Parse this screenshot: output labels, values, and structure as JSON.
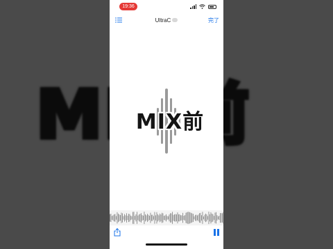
{
  "status_bar": {
    "time": "19:36"
  },
  "nav": {
    "title": "UltraC",
    "done_label": "完了"
  },
  "caption": {
    "text": "MIX前"
  },
  "background": {
    "text": "MIX前"
  },
  "colors": {
    "accent": "#1a73e8",
    "time_pill": "#e53935"
  },
  "icons": {
    "list": "list-icon",
    "share": "share-icon",
    "pause": "pause-icon",
    "wifi": "wifi-icon",
    "battery": "battery-icon"
  }
}
